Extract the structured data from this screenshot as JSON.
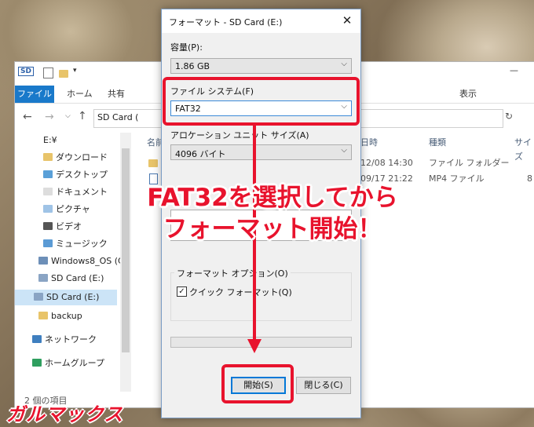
{
  "explorer": {
    "titlebar_icon": "SD",
    "minimize_glyph": "—",
    "ribbon_tabs": [
      "ファイル",
      "ホーム",
      "共有",
      "表示"
    ],
    "address_text": "SD Card (",
    "nav_items": [
      "E:¥",
      "ダウンロード",
      "デスクトップ",
      "ドキュメント",
      "ピクチャ",
      "ビデオ",
      "ミュージック",
      "Windows8_OS (C",
      "SD Card (E:)",
      "SD Card (E:)",
      "backup",
      "ネットワーク",
      "ホームグループ"
    ],
    "columns": [
      "名前",
      "日時",
      "種類",
      "サイズ"
    ],
    "files": [
      {
        "date": "12/08 14:30",
        "type": "ファイル フォルダー",
        "size": ""
      },
      {
        "date": "09/17 21:22",
        "type": "MP4 ファイル",
        "size": "8"
      }
    ],
    "status_text": "2 個の項目"
  },
  "dialog": {
    "title": "フォーマット - SD Card (E:)",
    "close_glyph": "✕",
    "capacity_label": "容量(P):",
    "capacity_value": "1.86 GB",
    "filesystem_label": "ファイル システム(F)",
    "filesystem_value": "FAT32",
    "allocation_label": "アロケーション ユニット サイズ(A)",
    "allocation_value": "4096 バイト",
    "options_title": "フォーマット オプション(O)",
    "quick_format_label": "クイック フォーマット(Q)",
    "quick_format_checked": true,
    "check_glyph": "✓",
    "start_button": "開始(S)",
    "close_button": "閉じる(C)",
    "combo_arrow": "⌵"
  },
  "annotation": {
    "line1": "FAT32を選択してから",
    "line2": "フォーマット開始！",
    "color": "#e8132d"
  },
  "logo": "ガルマックス"
}
